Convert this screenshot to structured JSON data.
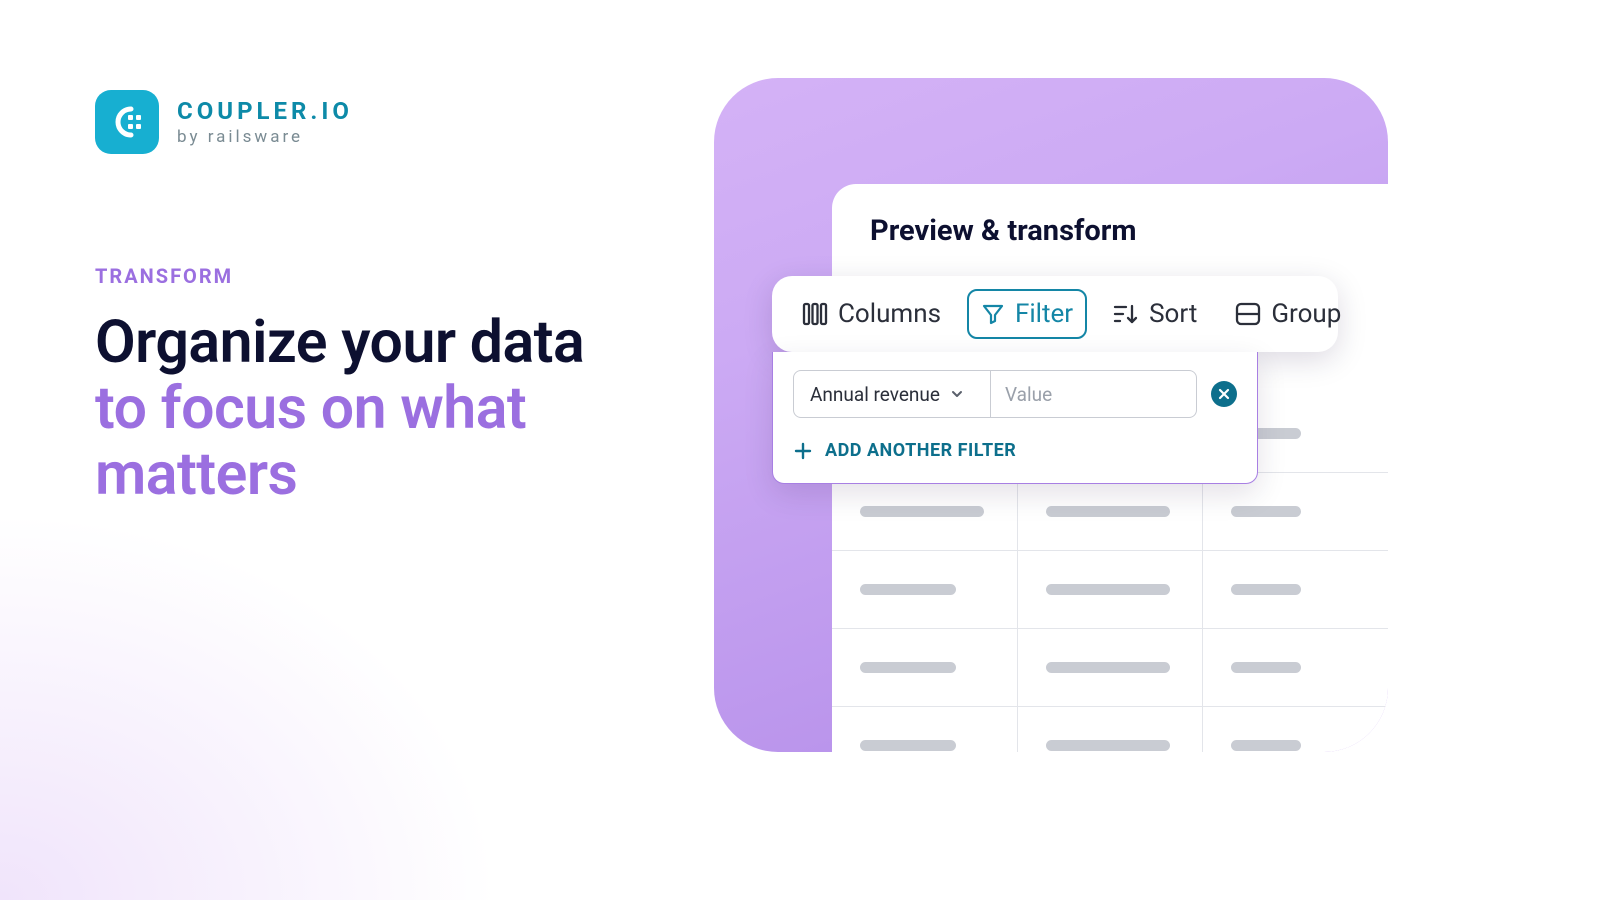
{
  "brand": {
    "name": "COUPLER.IO",
    "byline": "by railsware"
  },
  "eyebrow": "TRANSFORM",
  "headline_line1": "Organize your data",
  "headline_line2": "to focus on what matters",
  "card_title": "Preview & transform",
  "toolbar": {
    "columns": "Columns",
    "filter": "Filter",
    "sort": "Sort",
    "group": "Group"
  },
  "filter": {
    "field": "Annual revenue",
    "value_placeholder": "Value",
    "add_label": "ADD ANOTHER FILTER"
  }
}
